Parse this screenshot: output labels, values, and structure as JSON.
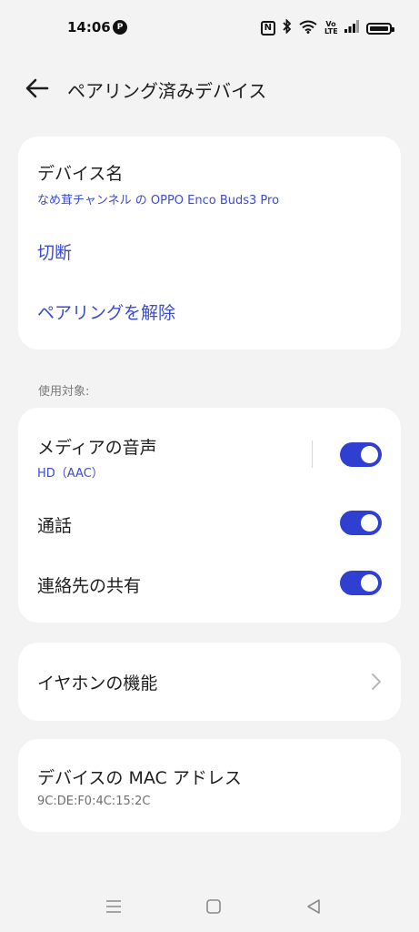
{
  "status": {
    "time": "14:06",
    "badge": "P",
    "nfc": "N",
    "volte": "Vo LTE"
  },
  "header": {
    "title": "ペアリング済みデバイス"
  },
  "device_card": {
    "name_label": "デバイス名",
    "name_value": "なめ茸チャンネル の OPPO Enco Buds3 Pro",
    "disconnect": "切断",
    "unpair": "ペアリングを解除"
  },
  "usage": {
    "section_label": "使用対象:",
    "media_audio": "メディアの音声",
    "media_codec": "HD（AAC）",
    "calls": "通話",
    "contact_sharing": "連絡先の共有",
    "toggles": {
      "media_audio": true,
      "calls": true,
      "contact_sharing": true
    }
  },
  "earphone": {
    "label": "イヤホンの機能"
  },
  "mac": {
    "label": "デバイスの MAC アドレス",
    "value": "9C:DE:F0:4C:15:2C"
  },
  "colors": {
    "accent": "#2f3fd0",
    "link": "#3b4bd3",
    "background": "#f3f3f3",
    "card": "#ffffff"
  },
  "icons": {
    "back": "arrow-left-icon",
    "chevron": "chevron-right-icon",
    "nav_menu": "menu-icon",
    "nav_home": "home-square-icon",
    "nav_back": "triangle-back-icon"
  }
}
